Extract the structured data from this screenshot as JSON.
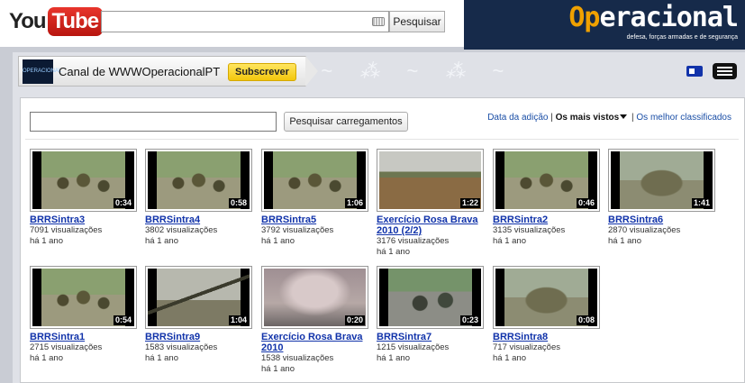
{
  "youtube": {
    "logo_you": "You",
    "logo_tube": "Tube",
    "search_value": "",
    "search_button": "Pesquisar"
  },
  "banner": {
    "title_highlight": "Op",
    "title_rest": "eracional",
    "subtitle": "defesa, forças armadas e de segurança"
  },
  "channel": {
    "avatar_text": "OPERACIONAL",
    "name": "Canal de WWWOperacionalPT",
    "subscribe_label": "Subscrever"
  },
  "uploads": {
    "search_value": "",
    "search_button": "Pesquisar carregamentos",
    "sort": {
      "by_date": "Data da adição",
      "separator": "|",
      "most_viewed": "Os mais vistos",
      "top_rated": "Os melhor classificados"
    }
  },
  "videos": [
    {
      "title": "BRRSintra3",
      "views": "7091 visualizações",
      "age": "há 1 ano",
      "duration": "0:34",
      "scene": "troops"
    },
    {
      "title": "BRRSintra4",
      "views": "3802 visualizações",
      "age": "há 1 ano",
      "duration": "0:58",
      "scene": "troops"
    },
    {
      "title": "BRRSintra5",
      "views": "3792 visualizações",
      "age": "há 1 ano",
      "duration": "1:06",
      "scene": "troops"
    },
    {
      "title": "Exercício Rosa Brava 2010 (2/2)",
      "views": "3176 visualizações",
      "age": "há 1 ano",
      "duration": "1:22",
      "scene": "field"
    },
    {
      "title": "BRRSintra2",
      "views": "3135 visualizações",
      "age": "há 1 ano",
      "duration": "0:46",
      "scene": "troops"
    },
    {
      "title": "BRRSintra6",
      "views": "2870 visualizações",
      "age": "há 1 ano",
      "duration": "1:41",
      "scene": "truck"
    },
    {
      "title": "BRRSintra1",
      "views": "2715 visualizações",
      "age": "há 1 ano",
      "duration": "0:54",
      "scene": "troops"
    },
    {
      "title": "BRRSintra9",
      "views": "1583 visualizações",
      "age": "há 1 ano",
      "duration": "1:04",
      "scene": "artillery"
    },
    {
      "title": "Exercício Rosa Brava 2010",
      "views": "1538 visualizações",
      "age": "há 1 ano",
      "duration": "0:20",
      "scene": "smoke"
    },
    {
      "title": "BRRSintra7",
      "views": "1215 visualizações",
      "age": "há 1 ano",
      "duration": "0:23",
      "scene": "street"
    },
    {
      "title": "BRRSintra8",
      "views": "717 visualizações",
      "age": "há 1 ano",
      "duration": "0:08",
      "scene": "truck"
    }
  ]
}
